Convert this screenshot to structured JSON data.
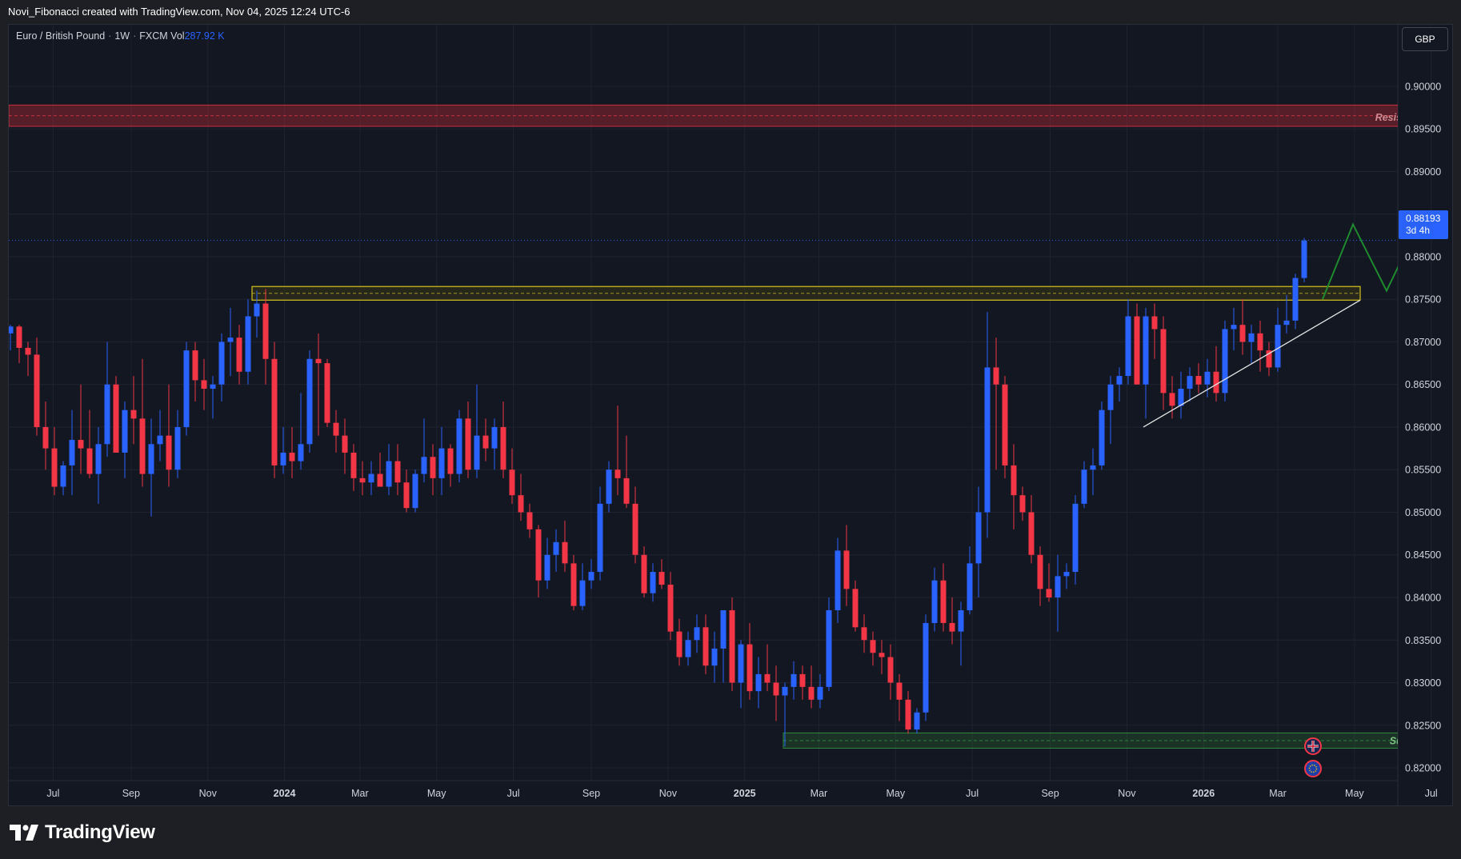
{
  "header": {
    "attribution": "Novi_Fibonacci created with TradingView.com, Nov 04, 2025 12:24 UTC-6"
  },
  "legend": {
    "symbol": "Euro / British Pound",
    "interval": "1W",
    "exchange": "FXCM",
    "vol_label": "Vol",
    "vol_value": "287.92 K"
  },
  "currency_button": "GBP",
  "last_price": {
    "price": "0.88193",
    "countdown": "3d 4h"
  },
  "brand": {
    "name": "TradingView"
  },
  "colors": {
    "up": "#2962ff",
    "down": "#f23645",
    "bg": "#131722",
    "resistance": "#b22833",
    "support": "#2e7d32",
    "range_box": "#d4c41c",
    "projection": "#1e8b2e",
    "trendline": "#e6e6e6"
  },
  "chart_data": {
    "type": "candlestick",
    "timeframe": "1W",
    "y_axis": {
      "ylim": [
        0.8185,
        0.9045
      ],
      "ticks": [
        "0.82000",
        "0.82500",
        "0.83000",
        "0.83500",
        "0.84000",
        "0.84500",
        "0.85000",
        "0.85500",
        "0.86000",
        "0.86500",
        "0.87000",
        "0.87500",
        "0.88000",
        "0.88500",
        "0.89000",
        "0.89500",
        "0.90000"
      ]
    },
    "x_axis": {
      "labels": [
        {
          "text": "Jul",
          "date": "2023-07-01",
          "bold": false
        },
        {
          "text": "Sep",
          "date": "2023-09-01",
          "bold": false
        },
        {
          "text": "Nov",
          "date": "2023-11-01",
          "bold": false
        },
        {
          "text": "2024",
          "date": "2024-01-01",
          "bold": true
        },
        {
          "text": "Mar",
          "date": "2024-03-01",
          "bold": false
        },
        {
          "text": "May",
          "date": "2024-05-01",
          "bold": false
        },
        {
          "text": "Jul",
          "date": "2024-07-01",
          "bold": false
        },
        {
          "text": "Sep",
          "date": "2024-09-01",
          "bold": false
        },
        {
          "text": "Nov",
          "date": "2024-11-01",
          "bold": false
        },
        {
          "text": "2025",
          "date": "2025-01-01",
          "bold": true
        },
        {
          "text": "Mar",
          "date": "2025-03-01",
          "bold": false
        },
        {
          "text": "May",
          "date": "2025-05-01",
          "bold": false
        },
        {
          "text": "Jul",
          "date": "2025-07-01",
          "bold": false
        },
        {
          "text": "Sep",
          "date": "2025-09-01",
          "bold": false
        },
        {
          "text": "Nov",
          "date": "2025-11-01",
          "bold": false
        },
        {
          "text": "2026",
          "date": "2026-01-01",
          "bold": true
        },
        {
          "text": "Mar",
          "date": "2026-03-01",
          "bold": false
        },
        {
          "text": "May",
          "date": "2026-05-01",
          "bold": false
        },
        {
          "text": "Jul",
          "date": "2026-07-01",
          "bold": false
        }
      ]
    },
    "candles": [
      {
        "o": 0.871,
        "h": 0.872,
        "l": 0.869,
        "c": 0.8718
      },
      {
        "o": 0.8718,
        "h": 0.872,
        "l": 0.8675,
        "c": 0.8693
      },
      {
        "o": 0.8693,
        "h": 0.87,
        "l": 0.866,
        "c": 0.8685
      },
      {
        "o": 0.8685,
        "h": 0.8705,
        "l": 0.859,
        "c": 0.86
      },
      {
        "o": 0.86,
        "h": 0.863,
        "l": 0.855,
        "c": 0.8575
      },
      {
        "o": 0.8575,
        "h": 0.86,
        "l": 0.852,
        "c": 0.853
      },
      {
        "o": 0.853,
        "h": 0.856,
        "l": 0.852,
        "c": 0.8555
      },
      {
        "o": 0.8555,
        "h": 0.862,
        "l": 0.852,
        "c": 0.8585
      },
      {
        "o": 0.8585,
        "h": 0.865,
        "l": 0.8545,
        "c": 0.8575
      },
      {
        "o": 0.8575,
        "h": 0.862,
        "l": 0.854,
        "c": 0.8545
      },
      {
        "o": 0.8545,
        "h": 0.86,
        "l": 0.851,
        "c": 0.858
      },
      {
        "o": 0.858,
        "h": 0.87,
        "l": 0.8565,
        "c": 0.865
      },
      {
        "o": 0.865,
        "h": 0.866,
        "l": 0.857,
        "c": 0.857
      },
      {
        "o": 0.857,
        "h": 0.863,
        "l": 0.854,
        "c": 0.862
      },
      {
        "o": 0.862,
        "h": 0.866,
        "l": 0.858,
        "c": 0.861
      },
      {
        "o": 0.861,
        "h": 0.868,
        "l": 0.853,
        "c": 0.8545
      },
      {
        "o": 0.8545,
        "h": 0.861,
        "l": 0.8495,
        "c": 0.858
      },
      {
        "o": 0.858,
        "h": 0.862,
        "l": 0.856,
        "c": 0.859
      },
      {
        "o": 0.859,
        "h": 0.865,
        "l": 0.853,
        "c": 0.855
      },
      {
        "o": 0.855,
        "h": 0.862,
        "l": 0.854,
        "c": 0.86
      },
      {
        "o": 0.86,
        "h": 0.87,
        "l": 0.859,
        "c": 0.869
      },
      {
        "o": 0.869,
        "h": 0.87,
        "l": 0.863,
        "c": 0.8655
      },
      {
        "o": 0.8655,
        "h": 0.868,
        "l": 0.862,
        "c": 0.8645
      },
      {
        "o": 0.8645,
        "h": 0.866,
        "l": 0.861,
        "c": 0.865
      },
      {
        "o": 0.865,
        "h": 0.871,
        "l": 0.863,
        "c": 0.87
      },
      {
        "o": 0.87,
        "h": 0.874,
        "l": 0.866,
        "c": 0.8705
      },
      {
        "o": 0.8705,
        "h": 0.872,
        "l": 0.865,
        "c": 0.8665
      },
      {
        "o": 0.8665,
        "h": 0.875,
        "l": 0.865,
        "c": 0.873
      },
      {
        "o": 0.873,
        "h": 0.876,
        "l": 0.8705,
        "c": 0.8745
      },
      {
        "o": 0.8745,
        "h": 0.8762,
        "l": 0.865,
        "c": 0.868
      },
      {
        "o": 0.868,
        "h": 0.87,
        "l": 0.854,
        "c": 0.8555
      },
      {
        "o": 0.8555,
        "h": 0.86,
        "l": 0.8545,
        "c": 0.857
      },
      {
        "o": 0.857,
        "h": 0.86,
        "l": 0.854,
        "c": 0.856
      },
      {
        "o": 0.856,
        "h": 0.864,
        "l": 0.855,
        "c": 0.858
      },
      {
        "o": 0.858,
        "h": 0.869,
        "l": 0.857,
        "c": 0.868
      },
      {
        "o": 0.868,
        "h": 0.871,
        "l": 0.859,
        "c": 0.8675
      },
      {
        "o": 0.8675,
        "h": 0.868,
        "l": 0.86,
        "c": 0.8605
      },
      {
        "o": 0.8605,
        "h": 0.862,
        "l": 0.857,
        "c": 0.859
      },
      {
        "o": 0.859,
        "h": 0.861,
        "l": 0.8545,
        "c": 0.857
      },
      {
        "o": 0.857,
        "h": 0.858,
        "l": 0.8525,
        "c": 0.854
      },
      {
        "o": 0.854,
        "h": 0.856,
        "l": 0.852,
        "c": 0.8535
      },
      {
        "o": 0.8535,
        "h": 0.856,
        "l": 0.852,
        "c": 0.8545
      },
      {
        "o": 0.8545,
        "h": 0.857,
        "l": 0.853,
        "c": 0.853
      },
      {
        "o": 0.853,
        "h": 0.858,
        "l": 0.852,
        "c": 0.856
      },
      {
        "o": 0.856,
        "h": 0.858,
        "l": 0.852,
        "c": 0.8535
      },
      {
        "o": 0.8535,
        "h": 0.855,
        "l": 0.85,
        "c": 0.8505
      },
      {
        "o": 0.8505,
        "h": 0.855,
        "l": 0.85,
        "c": 0.8545
      },
      {
        "o": 0.8545,
        "h": 0.861,
        "l": 0.8535,
        "c": 0.8565
      },
      {
        "o": 0.8565,
        "h": 0.858,
        "l": 0.852,
        "c": 0.854
      },
      {
        "o": 0.854,
        "h": 0.86,
        "l": 0.852,
        "c": 0.8575
      },
      {
        "o": 0.8575,
        "h": 0.858,
        "l": 0.853,
        "c": 0.8545
      },
      {
        "o": 0.8545,
        "h": 0.862,
        "l": 0.8535,
        "c": 0.861
      },
      {
        "o": 0.861,
        "h": 0.863,
        "l": 0.854,
        "c": 0.855
      },
      {
        "o": 0.855,
        "h": 0.865,
        "l": 0.854,
        "c": 0.859
      },
      {
        "o": 0.859,
        "h": 0.861,
        "l": 0.856,
        "c": 0.8575
      },
      {
        "o": 0.8575,
        "h": 0.861,
        "l": 0.855,
        "c": 0.86
      },
      {
        "o": 0.86,
        "h": 0.863,
        "l": 0.854,
        "c": 0.855
      },
      {
        "o": 0.855,
        "h": 0.8575,
        "l": 0.851,
        "c": 0.852
      },
      {
        "o": 0.852,
        "h": 0.8545,
        "l": 0.849,
        "c": 0.85
      },
      {
        "o": 0.85,
        "h": 0.851,
        "l": 0.847,
        "c": 0.848
      },
      {
        "o": 0.848,
        "h": 0.8485,
        "l": 0.84,
        "c": 0.842
      },
      {
        "o": 0.842,
        "h": 0.847,
        "l": 0.841,
        "c": 0.845
      },
      {
        "o": 0.845,
        "h": 0.848,
        "l": 0.843,
        "c": 0.8465
      },
      {
        "o": 0.8465,
        "h": 0.849,
        "l": 0.843,
        "c": 0.844
      },
      {
        "o": 0.844,
        "h": 0.845,
        "l": 0.8385,
        "c": 0.839
      },
      {
        "o": 0.839,
        "h": 0.844,
        "l": 0.8385,
        "c": 0.842
      },
      {
        "o": 0.842,
        "h": 0.8445,
        "l": 0.841,
        "c": 0.843
      },
      {
        "o": 0.843,
        "h": 0.853,
        "l": 0.842,
        "c": 0.851
      },
      {
        "o": 0.851,
        "h": 0.856,
        "l": 0.85,
        "c": 0.855
      },
      {
        "o": 0.855,
        "h": 0.8625,
        "l": 0.852,
        "c": 0.854
      },
      {
        "o": 0.854,
        "h": 0.859,
        "l": 0.8505,
        "c": 0.851
      },
      {
        "o": 0.851,
        "h": 0.853,
        "l": 0.844,
        "c": 0.845
      },
      {
        "o": 0.845,
        "h": 0.846,
        "l": 0.84,
        "c": 0.8405
      },
      {
        "o": 0.8405,
        "h": 0.844,
        "l": 0.8395,
        "c": 0.843
      },
      {
        "o": 0.843,
        "h": 0.8445,
        "l": 0.841,
        "c": 0.8415
      },
      {
        "o": 0.8415,
        "h": 0.843,
        "l": 0.835,
        "c": 0.836
      },
      {
        "o": 0.836,
        "h": 0.8375,
        "l": 0.832,
        "c": 0.833
      },
      {
        "o": 0.833,
        "h": 0.836,
        "l": 0.832,
        "c": 0.835
      },
      {
        "o": 0.835,
        "h": 0.838,
        "l": 0.8335,
        "c": 0.8365
      },
      {
        "o": 0.8365,
        "h": 0.838,
        "l": 0.831,
        "c": 0.832
      },
      {
        "o": 0.832,
        "h": 0.836,
        "l": 0.83,
        "c": 0.834
      },
      {
        "o": 0.834,
        "h": 0.8385,
        "l": 0.83,
        "c": 0.8385
      },
      {
        "o": 0.8385,
        "h": 0.84,
        "l": 0.829,
        "c": 0.83
      },
      {
        "o": 0.83,
        "h": 0.835,
        "l": 0.827,
        "c": 0.8345
      },
      {
        "o": 0.8345,
        "h": 0.837,
        "l": 0.828,
        "c": 0.829
      },
      {
        "o": 0.829,
        "h": 0.833,
        "l": 0.827,
        "c": 0.831
      },
      {
        "o": 0.831,
        "h": 0.8345,
        "l": 0.829,
        "c": 0.83
      },
      {
        "o": 0.83,
        "h": 0.832,
        "l": 0.8255,
        "c": 0.8285
      },
      {
        "o": 0.8285,
        "h": 0.83,
        "l": 0.8225,
        "c": 0.8295
      },
      {
        "o": 0.8295,
        "h": 0.8325,
        "l": 0.828,
        "c": 0.831
      },
      {
        "o": 0.831,
        "h": 0.832,
        "l": 0.828,
        "c": 0.8295
      },
      {
        "o": 0.8295,
        "h": 0.832,
        "l": 0.827,
        "c": 0.828
      },
      {
        "o": 0.828,
        "h": 0.831,
        "l": 0.827,
        "c": 0.8295
      },
      {
        "o": 0.8295,
        "h": 0.84,
        "l": 0.829,
        "c": 0.8385
      },
      {
        "o": 0.8385,
        "h": 0.847,
        "l": 0.837,
        "c": 0.8455
      },
      {
        "o": 0.8455,
        "h": 0.8485,
        "l": 0.839,
        "c": 0.841
      },
      {
        "o": 0.841,
        "h": 0.842,
        "l": 0.836,
        "c": 0.8365
      },
      {
        "o": 0.8365,
        "h": 0.838,
        "l": 0.8335,
        "c": 0.835
      },
      {
        "o": 0.835,
        "h": 0.836,
        "l": 0.832,
        "c": 0.8335
      },
      {
        "o": 0.8335,
        "h": 0.835,
        "l": 0.831,
        "c": 0.833
      },
      {
        "o": 0.833,
        "h": 0.8345,
        "l": 0.828,
        "c": 0.83
      },
      {
        "o": 0.83,
        "h": 0.831,
        "l": 0.8255,
        "c": 0.828
      },
      {
        "o": 0.828,
        "h": 0.829,
        "l": 0.824,
        "c": 0.8245
      },
      {
        "o": 0.8245,
        "h": 0.827,
        "l": 0.824,
        "c": 0.8265
      },
      {
        "o": 0.8265,
        "h": 0.838,
        "l": 0.8255,
        "c": 0.837
      },
      {
        "o": 0.837,
        "h": 0.8435,
        "l": 0.836,
        "c": 0.842
      },
      {
        "o": 0.842,
        "h": 0.844,
        "l": 0.836,
        "c": 0.837
      },
      {
        "o": 0.837,
        "h": 0.84,
        "l": 0.8345,
        "c": 0.836
      },
      {
        "o": 0.836,
        "h": 0.8395,
        "l": 0.832,
        "c": 0.8385
      },
      {
        "o": 0.8385,
        "h": 0.846,
        "l": 0.838,
        "c": 0.844
      },
      {
        "o": 0.844,
        "h": 0.853,
        "l": 0.84,
        "c": 0.85
      },
      {
        "o": 0.85,
        "h": 0.8735,
        "l": 0.847,
        "c": 0.867
      },
      {
        "o": 0.867,
        "h": 0.8705,
        "l": 0.855,
        "c": 0.865
      },
      {
        "o": 0.865,
        "h": 0.866,
        "l": 0.854,
        "c": 0.8555
      },
      {
        "o": 0.8555,
        "h": 0.858,
        "l": 0.848,
        "c": 0.852
      },
      {
        "o": 0.852,
        "h": 0.853,
        "l": 0.849,
        "c": 0.85
      },
      {
        "o": 0.85,
        "h": 0.852,
        "l": 0.844,
        "c": 0.845
      },
      {
        "o": 0.845,
        "h": 0.846,
        "l": 0.839,
        "c": 0.841
      },
      {
        "o": 0.841,
        "h": 0.844,
        "l": 0.8395,
        "c": 0.84
      },
      {
        "o": 0.84,
        "h": 0.845,
        "l": 0.836,
        "c": 0.8425
      },
      {
        "o": 0.8425,
        "h": 0.844,
        "l": 0.841,
        "c": 0.843
      },
      {
        "o": 0.843,
        "h": 0.852,
        "l": 0.8415,
        "c": 0.851
      },
      {
        "o": 0.851,
        "h": 0.856,
        "l": 0.8505,
        "c": 0.855
      },
      {
        "o": 0.855,
        "h": 0.8575,
        "l": 0.852,
        "c": 0.8555
      },
      {
        "o": 0.8555,
        "h": 0.863,
        "l": 0.855,
        "c": 0.862
      },
      {
        "o": 0.862,
        "h": 0.866,
        "l": 0.858,
        "c": 0.865
      },
      {
        "o": 0.865,
        "h": 0.867,
        "l": 0.863,
        "c": 0.866
      },
      {
        "o": 0.866,
        "h": 0.875,
        "l": 0.865,
        "c": 0.873
      },
      {
        "o": 0.873,
        "h": 0.8745,
        "l": 0.865,
        "c": 0.865
      },
      {
        "o": 0.865,
        "h": 0.874,
        "l": 0.861,
        "c": 0.873
      },
      {
        "o": 0.873,
        "h": 0.8745,
        "l": 0.868,
        "c": 0.8715
      },
      {
        "o": 0.8715,
        "h": 0.873,
        "l": 0.862,
        "c": 0.864
      },
      {
        "o": 0.864,
        "h": 0.866,
        "l": 0.861,
        "c": 0.8625
      },
      {
        "o": 0.8625,
        "h": 0.8665,
        "l": 0.861,
        "c": 0.8645
      },
      {
        "o": 0.8645,
        "h": 0.867,
        "l": 0.863,
        "c": 0.866
      },
      {
        "o": 0.866,
        "h": 0.8675,
        "l": 0.864,
        "c": 0.865
      },
      {
        "o": 0.865,
        "h": 0.868,
        "l": 0.8635,
        "c": 0.8665
      },
      {
        "o": 0.8665,
        "h": 0.8695,
        "l": 0.863,
        "c": 0.864
      },
      {
        "o": 0.864,
        "h": 0.8725,
        "l": 0.863,
        "c": 0.8715
      },
      {
        "o": 0.8715,
        "h": 0.874,
        "l": 0.869,
        "c": 0.872
      },
      {
        "o": 0.872,
        "h": 0.875,
        "l": 0.8685,
        "c": 0.87
      },
      {
        "o": 0.87,
        "h": 0.872,
        "l": 0.8675,
        "c": 0.871
      },
      {
        "o": 0.871,
        "h": 0.8725,
        "l": 0.8665,
        "c": 0.869
      },
      {
        "o": 0.869,
        "h": 0.87,
        "l": 0.866,
        "c": 0.867
      },
      {
        "o": 0.867,
        "h": 0.874,
        "l": 0.8665,
        "c": 0.872
      },
      {
        "o": 0.872,
        "h": 0.8755,
        "l": 0.871,
        "c": 0.8725
      },
      {
        "o": 0.8725,
        "h": 0.878,
        "l": 0.8715,
        "c": 0.8775
      },
      {
        "o": 0.8775,
        "h": 0.8822,
        "l": 0.877,
        "c": 0.8819
      }
    ],
    "zones": {
      "resistance": {
        "label": "Resistance",
        "from": 0.8953,
        "to": 0.8978
      },
      "support": {
        "label": "Support",
        "from": 0.8223,
        "to": 0.8241
      },
      "range_box": {
        "from": 0.8749,
        "to": 0.8765
      }
    },
    "last_price": 0.88193,
    "title": "",
    "xlabel": "",
    "ylabel": ""
  }
}
